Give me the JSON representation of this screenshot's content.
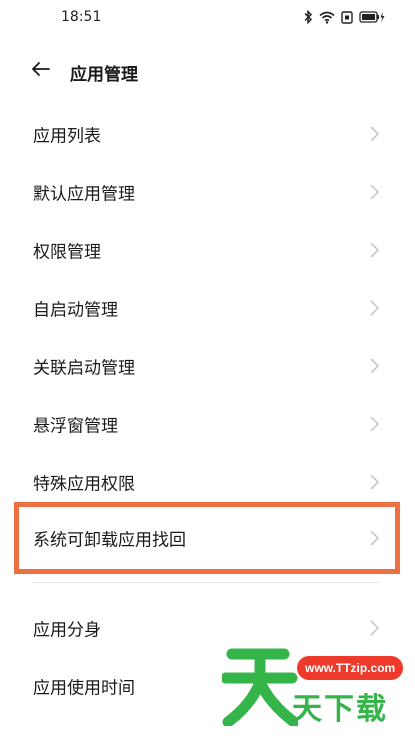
{
  "status_bar": {
    "time": "18:51",
    "icons": [
      "bluetooth-icon",
      "wifi-icon",
      "sim-icon",
      "battery-charging-icon"
    ]
  },
  "header": {
    "title": "应用管理",
    "back_icon": "arrow-left-icon"
  },
  "menu": {
    "items": [
      {
        "label": "应用列表"
      },
      {
        "label": "默认应用管理"
      },
      {
        "label": "权限管理"
      },
      {
        "label": "自启动管理"
      },
      {
        "label": "关联启动管理"
      },
      {
        "label": "悬浮窗管理"
      },
      {
        "label": "特殊应用权限"
      },
      {
        "label": "系统可卸载应用找回"
      },
      {
        "label": "应用分身"
      },
      {
        "label": "应用使用时间"
      }
    ],
    "highlighted_index": 7,
    "highlight_color": "#ee7040"
  },
  "watermark": {
    "url": "www.TTzip.com",
    "text": "天下载",
    "color_green": "#35b44a",
    "color_red": "#ee3a2a"
  }
}
